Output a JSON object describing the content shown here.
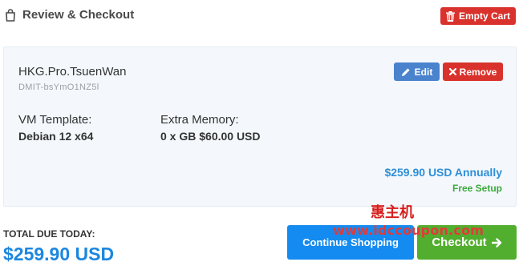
{
  "header": {
    "title": "Review & Checkout",
    "empty_cart_label": "Empty Cart"
  },
  "item": {
    "name": "HKG.Pro.TsuenWan",
    "id": "DMIT-bsYmO1NZ5l",
    "edit_label": "Edit",
    "remove_label": "Remove",
    "options": [
      {
        "label": "VM Template:",
        "value": "Debian 12 x64"
      },
      {
        "label": "Extra Memory:",
        "value": "0 x GB $60.00 USD"
      }
    ],
    "price": "$259.90 USD Annually",
    "setup": "Free Setup"
  },
  "summary": {
    "total_label": "TOTAL DUE TODAY:",
    "total_amount": "$259.90 USD"
  },
  "actions": {
    "continue_label": "Continue Shopping",
    "checkout_label": "Checkout"
  },
  "watermark": {
    "chinese": "惠主机",
    "url": "www.idccoupon.com"
  },
  "colors": {
    "danger": "#d9322d",
    "primary": "#4a83cd",
    "continue": "#148bf0",
    "checkout": "#52ae2e",
    "price": "#2f8fd8",
    "free_setup": "#3aa93a"
  },
  "icons": {
    "header": "shopping-bag-icon",
    "empty_cart": "trash-icon",
    "edit": "pencil-icon",
    "remove": "times-icon",
    "checkout": "arrow-right-icon"
  }
}
